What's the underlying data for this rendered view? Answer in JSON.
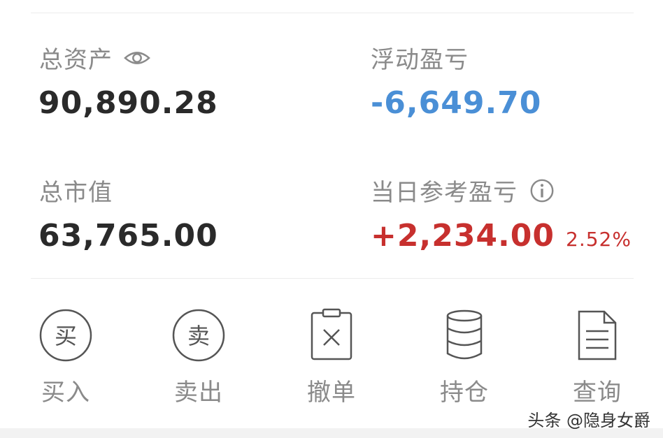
{
  "summary": {
    "total_assets": {
      "label": "总资产",
      "value": "90,890.28"
    },
    "floating_pnl": {
      "label": "浮动盈亏",
      "value": "-6,649.70"
    },
    "market_value": {
      "label": "总市值",
      "value": "63,765.00"
    },
    "daily_pnl": {
      "label": "当日参考盈亏",
      "value": "+2,234.00",
      "percent": "2.52%"
    }
  },
  "actions": [
    {
      "label": "买入",
      "icon_char": "买",
      "icon": "buy-circle-icon"
    },
    {
      "label": "卖出",
      "icon_char": "卖",
      "icon": "sell-circle-icon"
    },
    {
      "label": "撤单",
      "icon": "cancel-order-clipboard-icon"
    },
    {
      "label": "持仓",
      "icon": "position-database-icon"
    },
    {
      "label": "查询",
      "icon": "query-document-icon"
    }
  ],
  "watermark": "头条 @隐身女爵",
  "colors": {
    "negative": "#4a8fd6",
    "positive": "#c7302e",
    "label_gray": "#8a8a8a",
    "value_dark": "#2a2a2a"
  }
}
